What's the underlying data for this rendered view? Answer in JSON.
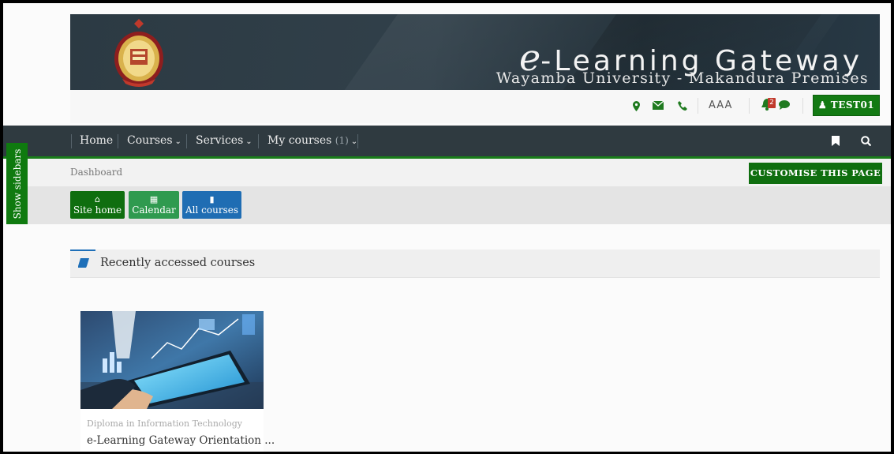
{
  "banner": {
    "title_e": "e",
    "title_rest": "-Learning Gateway",
    "subtitle": "Wayamba University - Makandura Premises",
    "logo": "university-crest-logo"
  },
  "utility": {
    "icons": [
      "map-marker-icon",
      "envelope-icon",
      "phone-icon"
    ],
    "font_size_label": "AAA",
    "notification_count": "2",
    "user_button": "TEST01"
  },
  "nav": {
    "items": [
      {
        "label": "Home"
      },
      {
        "label": "Courses"
      },
      {
        "label": "Services"
      },
      {
        "label": "My courses",
        "count": "(1)"
      }
    ],
    "tools": [
      "bookmark-icon",
      "search-icon"
    ]
  },
  "sidebar_toggle": "Show sidebars",
  "breadcrumb": "Dashboard",
  "customise_button": "CUSTOMISE THIS PAGE",
  "quick_buttons": [
    {
      "label": "Site home",
      "icon": "home-icon",
      "color": "#0f6e0f"
    },
    {
      "label": "Calendar",
      "icon": "calendar-icon",
      "color": "#2f9a4f"
    },
    {
      "label": "All courses",
      "icon": "book-icon",
      "color": "#1f6db3"
    }
  ],
  "recent": {
    "title": "Recently accessed courses",
    "course": {
      "category": "Diploma in Information Technology",
      "name": "e-Learning Gateway Orientation ..."
    }
  },
  "colors": {
    "nav_bg": "#2f3a40",
    "accent_green": "#0f6e0f",
    "accent_blue": "#1f6db3"
  }
}
